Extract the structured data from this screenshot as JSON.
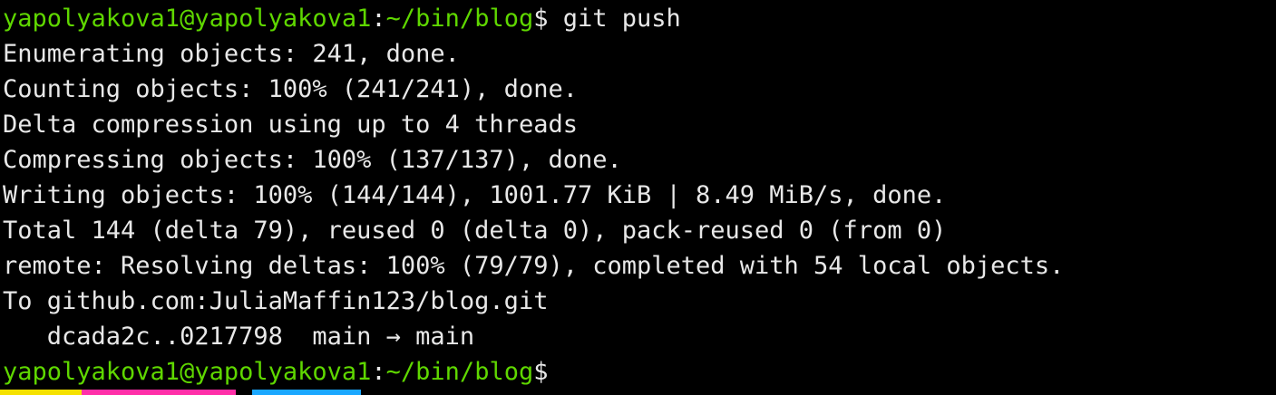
{
  "terminal": {
    "prompt_user_host": "yapolyakova1@yapolyakova1",
    "prompt_colon": ":",
    "prompt_path": "~/bin/blog",
    "prompt_symbol": "$",
    "command": " git push",
    "output_lines": [
      "Enumerating objects: 241, done.",
      "Counting objects: 100% (241/241), done.",
      "Delta compression using up to 4 threads",
      "Compressing objects: 100% (137/137), done.",
      "Writing objects: 100% (144/144), 1001.77 KiB | 8.49 MiB/s, done.",
      "Total 144 (delta 79), reused 0 (delta 0), pack-reused 0 (from 0)",
      "remote: Resolving deltas: 100% (79/79), completed with 54 local objects.",
      "To github.com:JuliaMaffin123/blog.git",
      "   dcada2c..0217798  main → main"
    ]
  },
  "colors": {
    "background": "#000000",
    "foreground": "#e8e8e8",
    "prompt": "#5fd700",
    "statusbar_yellow": "#f5e100",
    "statusbar_pink": "#ff2fa8",
    "statusbar_blue": "#1aa7ff"
  }
}
